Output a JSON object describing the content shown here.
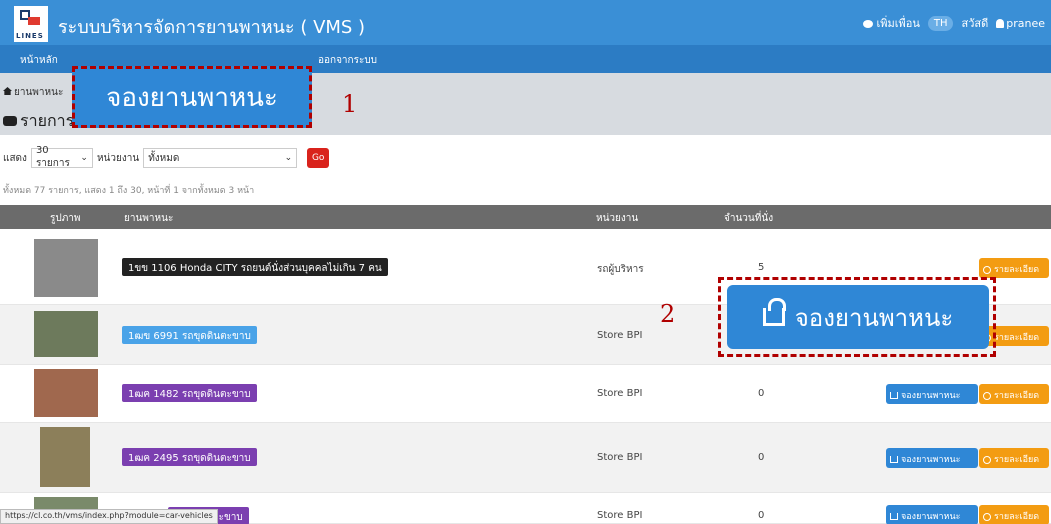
{
  "app": {
    "logo_text": "LINES",
    "title": "ระบบบริหารจัดการยานพาหนะ ( VMS )",
    "add_friend": "เพิ่มเพื่อน",
    "lang": "TH",
    "greeting": "สวัสดี",
    "username": "pranee"
  },
  "nav": {
    "home": "หน้าหลัก",
    "logout": "ออกจากระบบ"
  },
  "breadcrumb": "ยานพาหนะ",
  "page_heading": "รายการยานพาหนะ",
  "callout1": {
    "label": "จองยานพาหนะ",
    "number": "1"
  },
  "callout2": {
    "label": "จองยานพาหนะ",
    "number": "2"
  },
  "filter": {
    "show_label": "แสดง",
    "show_value": "30 รายการ",
    "unit_label": "หน่วยงาน",
    "unit_value": "ทั้งหมด",
    "go": "Go"
  },
  "summary": "ทั้งหมด 77 รายการ, แสดง 1 ถึง 30, หน้าที่ 1 จากทั้งหมด 3 หน้า",
  "table": {
    "headers": {
      "image": "รูปภาพ",
      "vehicle": "ยานพาหนะ",
      "unit": "หน่วยงาน",
      "seats": "จำนวนที่นั่ง"
    },
    "rows": [
      {
        "vehicle": "1ขข 1106 Honda CITY รถยนต์นั่งส่วนบุคคลไม่เกิน 7 คน",
        "unit": "รถผู้บริหาร",
        "seats": "5",
        "badge_color": "#222222",
        "book": "",
        "detail": "รายละเอียด"
      },
      {
        "vehicle": "1ฒข 6991 รถขุดดินตะขาบ",
        "unit": "Store BPI",
        "seats": "",
        "badge_color": "#4aa3e8",
        "book": "",
        "detail": "รายละเอียด"
      },
      {
        "vehicle": "1ฒฅ 1482 รถขุดดินตะขาบ",
        "unit": "Store BPI",
        "seats": "0",
        "badge_color": "#7b3fb0",
        "book": "จองยานพาหนะ",
        "detail": "รายละเอียด"
      },
      {
        "vehicle": "1ฒฅ 2495 รถขุดดินตะขาบ",
        "unit": "Store BPI",
        "seats": "0",
        "badge_color": "#7b3fb0",
        "book": "จองยานพาหนะ",
        "detail": "รายละเอียด"
      },
      {
        "vehicle": "รถขุดดินตะขาบ",
        "unit": "Store BPI",
        "seats": "0",
        "badge_color": "#7b3fb0",
        "book": "จองยานพาหนะ",
        "detail": "รายละเอียด"
      }
    ]
  },
  "status_url": "https://cl.co.th/vms/index.php?module=car-vehicles"
}
